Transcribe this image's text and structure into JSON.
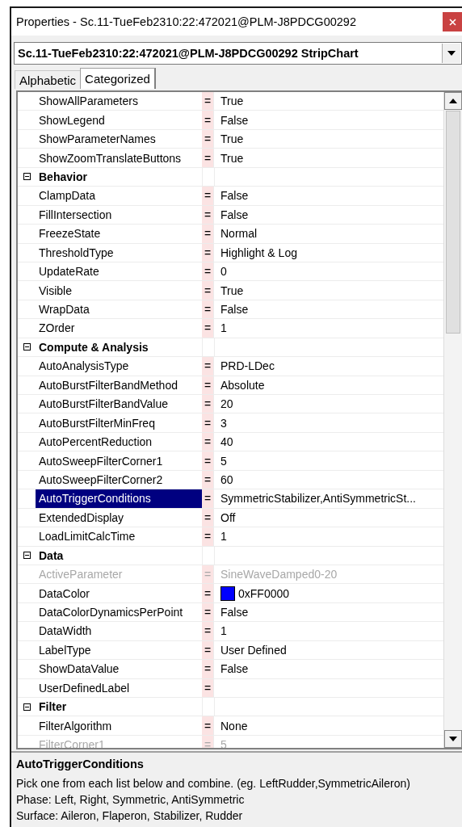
{
  "window": {
    "title": "Properties - Sc.11-TueFeb2310:22:472021@PLM-J8PDCG00292"
  },
  "object_selector": {
    "value": "Sc.11-TueFeb2310:22:472021@PLM-J8PDCG00292 StripChart"
  },
  "tabs": [
    {
      "label": "Alphabetic",
      "selected": false
    },
    {
      "label": "Categorized",
      "selected": true
    }
  ],
  "grid": {
    "rows": [
      {
        "kind": "property",
        "name": "ShowAllParameters",
        "separator": "=",
        "value": "True",
        "selected": false,
        "disabled": false
      },
      {
        "kind": "property",
        "name": "ShowLegend",
        "separator": "=",
        "value": "False",
        "selected": false,
        "disabled": false
      },
      {
        "kind": "property",
        "name": "ShowParameterNames",
        "separator": "=",
        "value": "True",
        "selected": false,
        "disabled": false
      },
      {
        "kind": "property",
        "name": "ShowZoomTranslateButtons",
        "separator": "=",
        "value": "True",
        "selected": false,
        "disabled": false
      },
      {
        "kind": "category",
        "name": "Behavior",
        "expanded": true
      },
      {
        "kind": "property",
        "name": "ClampData",
        "separator": "=",
        "value": "False",
        "selected": false,
        "disabled": false
      },
      {
        "kind": "property",
        "name": "FillIntersection",
        "separator": "=",
        "value": "False",
        "selected": false,
        "disabled": false
      },
      {
        "kind": "property",
        "name": "FreezeState",
        "separator": "=",
        "value": "Normal",
        "selected": false,
        "disabled": false
      },
      {
        "kind": "property",
        "name": "ThresholdType",
        "separator": "=",
        "value": "Highlight & Log",
        "selected": false,
        "disabled": false
      },
      {
        "kind": "property",
        "name": "UpdateRate",
        "separator": "=",
        "value": "0",
        "selected": false,
        "disabled": false
      },
      {
        "kind": "property",
        "name": "Visible",
        "separator": "=",
        "value": "True",
        "selected": false,
        "disabled": false
      },
      {
        "kind": "property",
        "name": "WrapData",
        "separator": "=",
        "value": "False",
        "selected": false,
        "disabled": false
      },
      {
        "kind": "property",
        "name": "ZOrder",
        "separator": "=",
        "value": "1",
        "selected": false,
        "disabled": false
      },
      {
        "kind": "category",
        "name": "Compute & Analysis",
        "expanded": true
      },
      {
        "kind": "property",
        "name": "AutoAnalysisType",
        "separator": "=",
        "value": "PRD-LDec",
        "selected": false,
        "disabled": false
      },
      {
        "kind": "property",
        "name": "AutoBurstFilterBandMethod",
        "separator": "=",
        "value": "Absolute",
        "selected": false,
        "disabled": false
      },
      {
        "kind": "property",
        "name": "AutoBurstFilterBandValue",
        "separator": "=",
        "value": "20",
        "selected": false,
        "disabled": false
      },
      {
        "kind": "property",
        "name": "AutoBurstFilterMinFreq",
        "separator": "=",
        "value": "3",
        "selected": false,
        "disabled": false
      },
      {
        "kind": "property",
        "name": "AutoPercentReduction",
        "separator": "=",
        "value": "40",
        "selected": false,
        "disabled": false
      },
      {
        "kind": "property",
        "name": "AutoSweepFilterCorner1",
        "separator": "=",
        "value": "5",
        "selected": false,
        "disabled": false
      },
      {
        "kind": "property",
        "name": "AutoSweepFilterCorner2",
        "separator": "=",
        "value": "60",
        "selected": false,
        "disabled": false
      },
      {
        "kind": "property",
        "name": "AutoTriggerConditions",
        "separator": "=",
        "value": "SymmetricStabilizer,AntiSymmetricSt...",
        "selected": true,
        "disabled": false
      },
      {
        "kind": "property",
        "name": "ExtendedDisplay",
        "separator": "=",
        "value": "Off",
        "selected": false,
        "disabled": false
      },
      {
        "kind": "property",
        "name": "LoadLimitCalcTime",
        "separator": "=",
        "value": "1",
        "selected": false,
        "disabled": false
      },
      {
        "kind": "category",
        "name": "Data",
        "expanded": true
      },
      {
        "kind": "property",
        "name": "ActiveParameter",
        "separator": "=",
        "value": "SineWaveDamped0-20",
        "selected": false,
        "disabled": true
      },
      {
        "kind": "property",
        "name": "DataColor",
        "separator": "=",
        "value": "0xFF0000",
        "color": "#0000ff",
        "selected": false,
        "disabled": false
      },
      {
        "kind": "property",
        "name": "DataColorDynamicsPerPoint",
        "separator": "=",
        "value": "False",
        "selected": false,
        "disabled": false
      },
      {
        "kind": "property",
        "name": "DataWidth",
        "separator": "=",
        "value": "1",
        "selected": false,
        "disabled": false
      },
      {
        "kind": "property",
        "name": "LabelType",
        "separator": "=",
        "value": "User Defined",
        "selected": false,
        "disabled": false
      },
      {
        "kind": "property",
        "name": "ShowDataValue",
        "separator": "=",
        "value": "False",
        "selected": false,
        "disabled": false
      },
      {
        "kind": "property",
        "name": "UserDefinedLabel",
        "separator": "=",
        "selected": false,
        "disabled": false
      },
      {
        "kind": "category",
        "name": "Filter",
        "expanded": true
      },
      {
        "kind": "property",
        "name": "FilterAlgorithm",
        "separator": "=",
        "value": "None",
        "selected": false,
        "disabled": false
      },
      {
        "kind": "property",
        "name": "FilterCorner1",
        "separator": "=",
        "value": "5",
        "selected": false,
        "disabled": true
      }
    ]
  },
  "description": {
    "title": "AutoTriggerConditions",
    "lines": [
      "Pick one from each list below and combine. (eg. LeftRudder,SymmetricAileron)",
      "Phase: Left, Right, Symmetric, AntiSymmetric",
      "Surface: Aileron, Flaperon, Stabilizer, Rudder"
    ]
  }
}
